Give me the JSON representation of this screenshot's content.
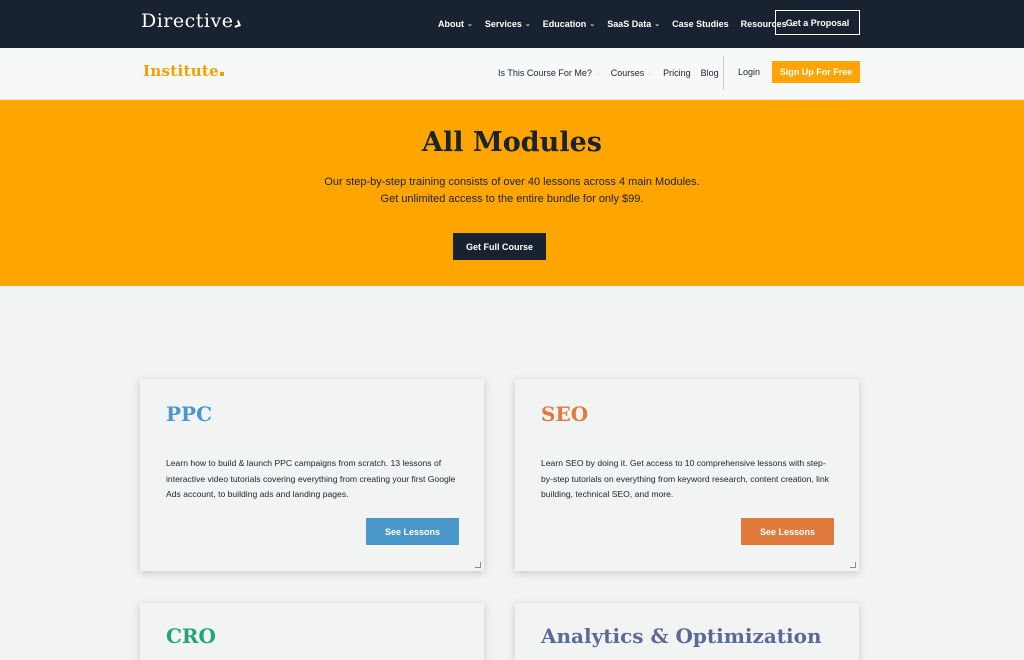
{
  "top": {
    "brand": "Directive",
    "nav": [
      {
        "label": "About",
        "dropdown": true
      },
      {
        "label": "Services",
        "dropdown": true
      },
      {
        "label": "Education",
        "dropdown": true
      },
      {
        "label": "SaaS Data",
        "dropdown": true
      },
      {
        "label": "Case Studies",
        "dropdown": false
      },
      {
        "label": "Resources",
        "dropdown": true
      }
    ],
    "cta": "Get a Proposal"
  },
  "sub": {
    "brand": "Institute",
    "nav": [
      {
        "label": "Is This Course For Me?",
        "dropdown": true
      },
      {
        "label": "Courses",
        "dropdown": true
      },
      {
        "label": "Pricing",
        "dropdown": false
      },
      {
        "label": "Blog",
        "dropdown": false
      }
    ],
    "login": "Login",
    "signup": "Sign Up For Free"
  },
  "hero": {
    "title": "All Modules",
    "line1": "Our step-by-step training consists of over 40 lessons across 4 main Modules.",
    "line2": "Get unlimited access to the entire bundle for only $99.",
    "cta": "Get Full Course"
  },
  "modules": [
    {
      "title": "PPC",
      "color": "#4a97c9",
      "description": "Learn how to build & launch PPC campaigns from scratch. 13 lessons of interactive video tutorials covering everything from creating your first Google Ads account, to building ads and landing pages.",
      "button": "See Lessons"
    },
    {
      "title": "SEO",
      "color": "#e07b3d",
      "description": "Learn SEO by doing it. Get access to 10 comprehensive lessons with step-by-step tutorials on everything from keyword research, content creation, link building, technical SEO, and more.",
      "button": "See Lessons"
    },
    {
      "title": "CRO",
      "color": "#1fa579"
    },
    {
      "title": "Analytics & Optimization",
      "color": "#5d6a98"
    }
  ]
}
